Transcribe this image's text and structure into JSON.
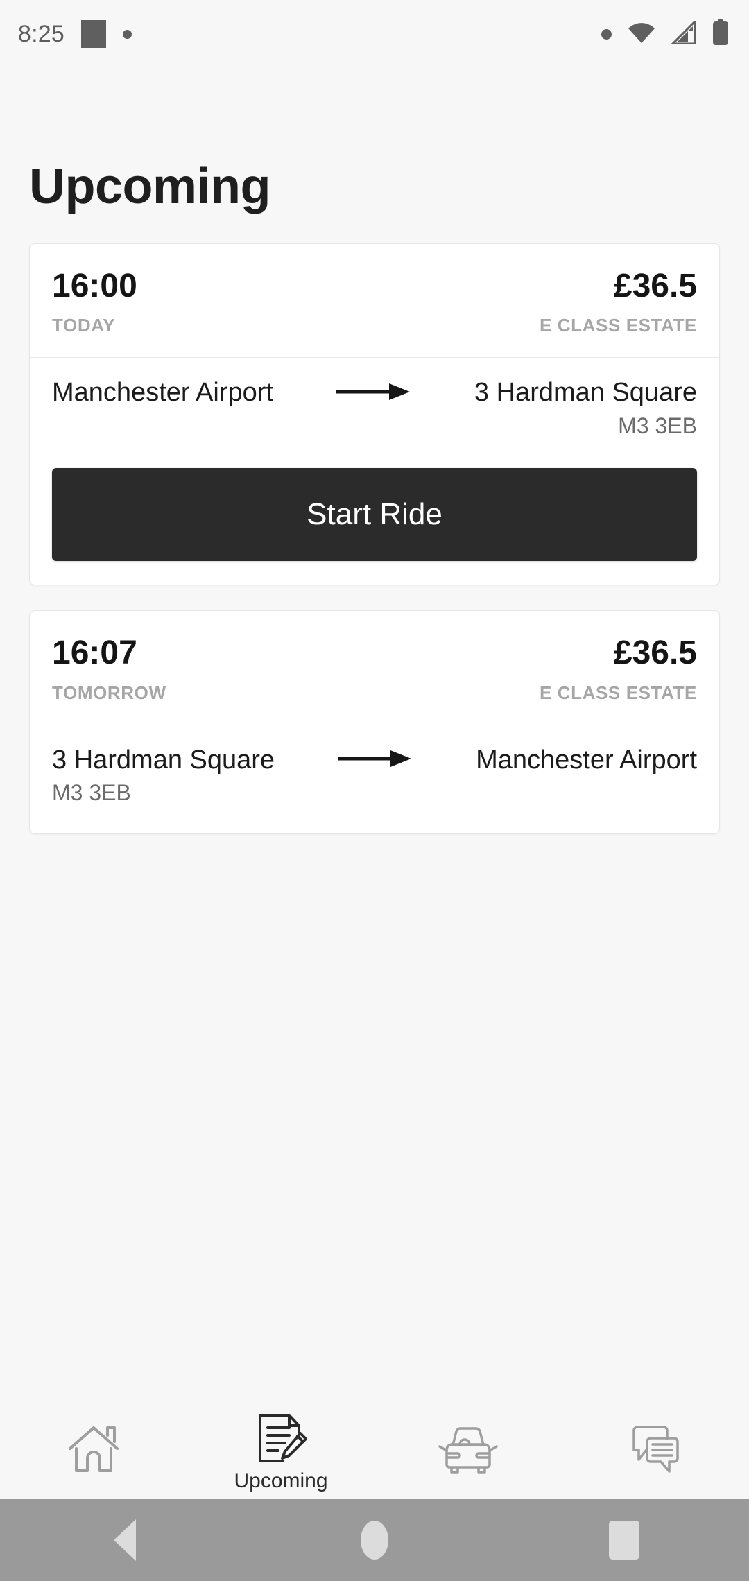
{
  "status_bar": {
    "time": "8:25",
    "left_icons": [
      "square-badge-icon",
      "dot-icon"
    ],
    "right_icons": [
      "dot-icon",
      "wifi-icon",
      "cellular-signal-icon",
      "battery-icon"
    ]
  },
  "header": {
    "title": "Upcoming"
  },
  "rides": [
    {
      "time": "16:00",
      "day": "TODAY",
      "price": "£36.5",
      "vehicle": "E CLASS ESTATE",
      "origin": "Manchester Airport",
      "origin_postcode": "",
      "destination": "3 Hardman Square",
      "destination_postcode": "M3 3EB",
      "arrow": "⟶",
      "action_label": "Start Ride",
      "has_action": true
    },
    {
      "time": "16:07",
      "day": "TOMORROW",
      "price": "£36.5",
      "vehicle": "E CLASS ESTATE",
      "origin": "3 Hardman Square",
      "origin_postcode": "M3 3EB",
      "destination": "Manchester Airport",
      "destination_postcode": "",
      "arrow": "⟶",
      "action_label": "",
      "has_action": false
    }
  ],
  "tabs": [
    {
      "icon": "home-icon",
      "label": "",
      "active": false
    },
    {
      "icon": "document-pencil-icon",
      "label": "Upcoming",
      "active": true
    },
    {
      "icon": "car-icon",
      "label": "",
      "active": false
    },
    {
      "icon": "chat-bubbles-icon",
      "label": "",
      "active": false
    }
  ],
  "system_nav": {
    "back": "back-triangle-icon",
    "home": "home-circle-icon",
    "recents": "recents-square-icon"
  },
  "colors": {
    "page_background": "#f7f7f7",
    "card_background": "#ffffff",
    "card_border": "#e6e6e6",
    "primary_text": "#151515",
    "muted_text": "#a6a6a6",
    "postcode_text": "#6a6a6a",
    "button_background": "#2b2b2b",
    "button_text": "#ffffff",
    "tab_icon_inactive": "#9e9e9e",
    "tab_icon_active": "#2a2a2a",
    "system_nav_background": "#9a9a9a",
    "system_nav_icon": "#dcdcdc"
  }
}
